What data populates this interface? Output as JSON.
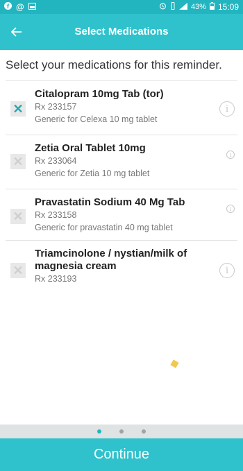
{
  "status_bar": {
    "left_icons": [
      "facebook-icon",
      "at-icon",
      "image-icon"
    ],
    "right_icons": [
      "alarm-icon",
      "vibrate-icon",
      "signal-icon"
    ],
    "battery": "43%",
    "time": "15:09"
  },
  "header": {
    "title": "Select Medications",
    "back_icon": "arrow-left-icon"
  },
  "instruction": "Select your medications for this reminder.",
  "medications": [
    {
      "name": "Citalopram 10mg Tab (tor)",
      "rx": "Rx  233157",
      "generic": "Generic for Celexa 10 mg tablet",
      "selected": true
    },
    {
      "name": "Zetia Oral Tablet 10mg",
      "rx": "Rx  233064",
      "generic": "Generic for Zetia 10 mg tablet",
      "selected": false
    },
    {
      "name": "Pravastatin Sodium 40 Mg Tab",
      "rx": "Rx  233158",
      "generic": "Generic for pravastatin 40 mg tablet",
      "selected": false
    },
    {
      "name": "Triamcinolone / nystian/milk of magnesia  cream",
      "rx": "Rx  233193",
      "generic": "",
      "selected": false
    }
  ],
  "pager": {
    "count": 3,
    "active_index": 0
  },
  "continue_label": "Continue",
  "colors": {
    "primary": "#2fc2cc",
    "status_bar": "#22b5c0",
    "check_on": "#23a7b3",
    "accent_diamond": "#f2c94c"
  }
}
